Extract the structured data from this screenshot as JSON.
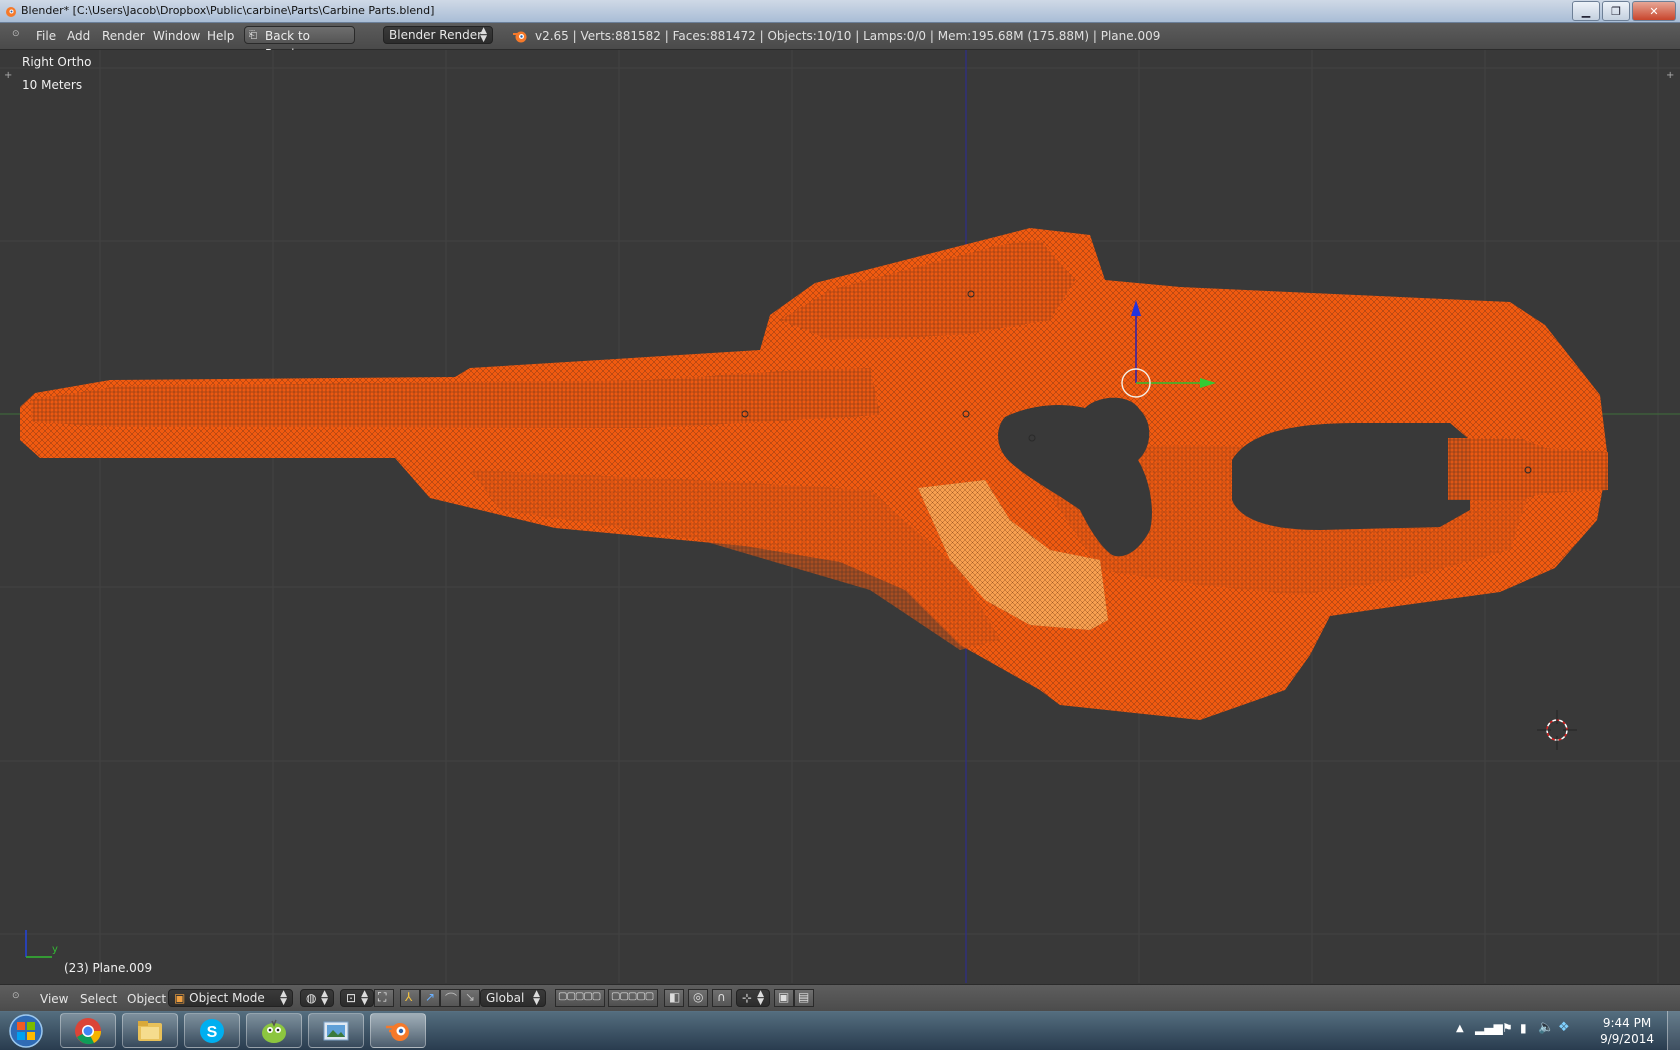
{
  "window": {
    "title": "Blender* [C:\\Users\\Jacob\\Dropbox\\Public\\carbine\\Parts\\Carbine Parts.blend]",
    "controls": [
      "minimize",
      "maximize",
      "close"
    ]
  },
  "infobar": {
    "menus": [
      "File",
      "Add",
      "Render",
      "Window",
      "Help"
    ],
    "back_button": "Back to Previous",
    "render_engine": "Blender Render",
    "stats": "v2.65 | Verts:881582 | Faces:881472 | Objects:10/10 | Lamps:0/0 | Mem:195.68M (175.88M) | Plane.009"
  },
  "viewport": {
    "view_name": "Right Ortho",
    "scale": "10 Meters",
    "object_info": "(23) Plane.009",
    "axis_label": "y",
    "mesh_color": "#f05a10",
    "background": "#393939"
  },
  "header3d": {
    "menus": [
      "View",
      "Select",
      "Object"
    ],
    "mode": "Object Mode",
    "orientation": "Global"
  },
  "taskbar": {
    "apps": [
      "chrome-icon",
      "file-explorer-icon",
      "skype-icon",
      "game-icon",
      "photo-viewer-icon",
      "blender-icon"
    ],
    "time": "9:44 PM",
    "date": "9/9/2014"
  }
}
